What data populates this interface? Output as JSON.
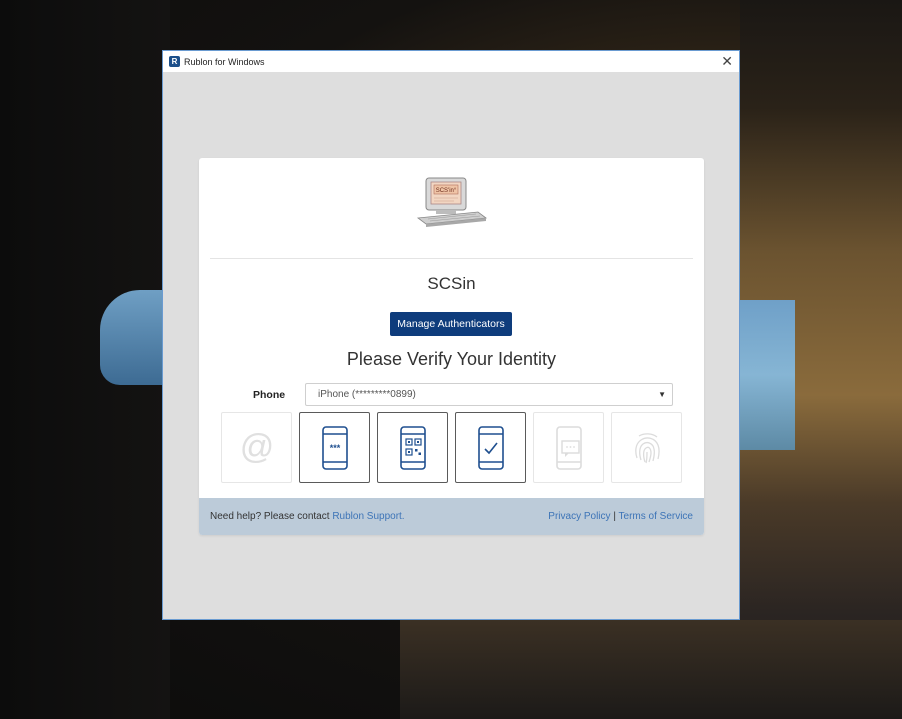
{
  "window": {
    "title": "Rublon for Windows",
    "icon_letter": "R",
    "close_glyph": "✕"
  },
  "card": {
    "logo_text": "SCS'in°",
    "brand_name": "SCSin",
    "manage_button_label": "Manage Authenticators",
    "verify_title": "Please Verify Your Identity",
    "phone_label": "Phone",
    "device_selected": "iPhone (*********0899)",
    "methods": [
      {
        "icon": "email-at-icon",
        "enabled": false
      },
      {
        "icon": "phone-passcode-icon",
        "enabled": true
      },
      {
        "icon": "phone-qr-code-icon",
        "enabled": true
      },
      {
        "icon": "phone-push-check-icon",
        "enabled": true
      },
      {
        "icon": "phone-sms-icon",
        "enabled": false
      },
      {
        "icon": "fingerprint-icon",
        "enabled": false
      }
    ]
  },
  "footer": {
    "help_text": "Need help? Please contact ",
    "help_link": "Rublon Support.",
    "privacy_link": "Privacy Policy",
    "separator": " | ",
    "terms_link": "Terms of Service"
  },
  "colors": {
    "primary_button": "#0e3c7c",
    "link": "#3d74b7",
    "footer_bg": "#bccbd9"
  }
}
